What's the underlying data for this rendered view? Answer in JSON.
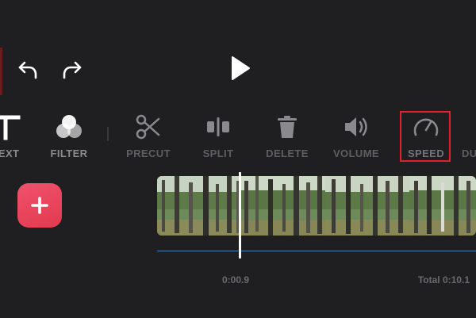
{
  "icons": {
    "undo": "undo-icon",
    "redo": "redo-icon",
    "play": "play-icon",
    "add": "plus-icon"
  },
  "toolbar": {
    "items": [
      {
        "label": "TEXT",
        "icon": "text-icon"
      },
      {
        "label": "FILTER",
        "icon": "filter-icon"
      },
      {
        "label": "PRECUT",
        "icon": "scissors-icon"
      },
      {
        "label": "SPLIT",
        "icon": "split-icon"
      },
      {
        "label": "DELETE",
        "icon": "trash-icon"
      },
      {
        "label": "VOLUME",
        "icon": "volume-icon"
      },
      {
        "label": "SPEED",
        "icon": "speedometer-icon"
      },
      {
        "label": "DU",
        "icon": "duplicate-icon"
      }
    ]
  },
  "timeline": {
    "current_time": "0:00.9",
    "total_time": "Total 0:10.1"
  },
  "colors": {
    "background": "#1f1f21",
    "accent_red": "#e0212b",
    "add_button": "#e8455e",
    "timeline_line": "#4a7fb0",
    "label_muted": "#5f5f63"
  }
}
